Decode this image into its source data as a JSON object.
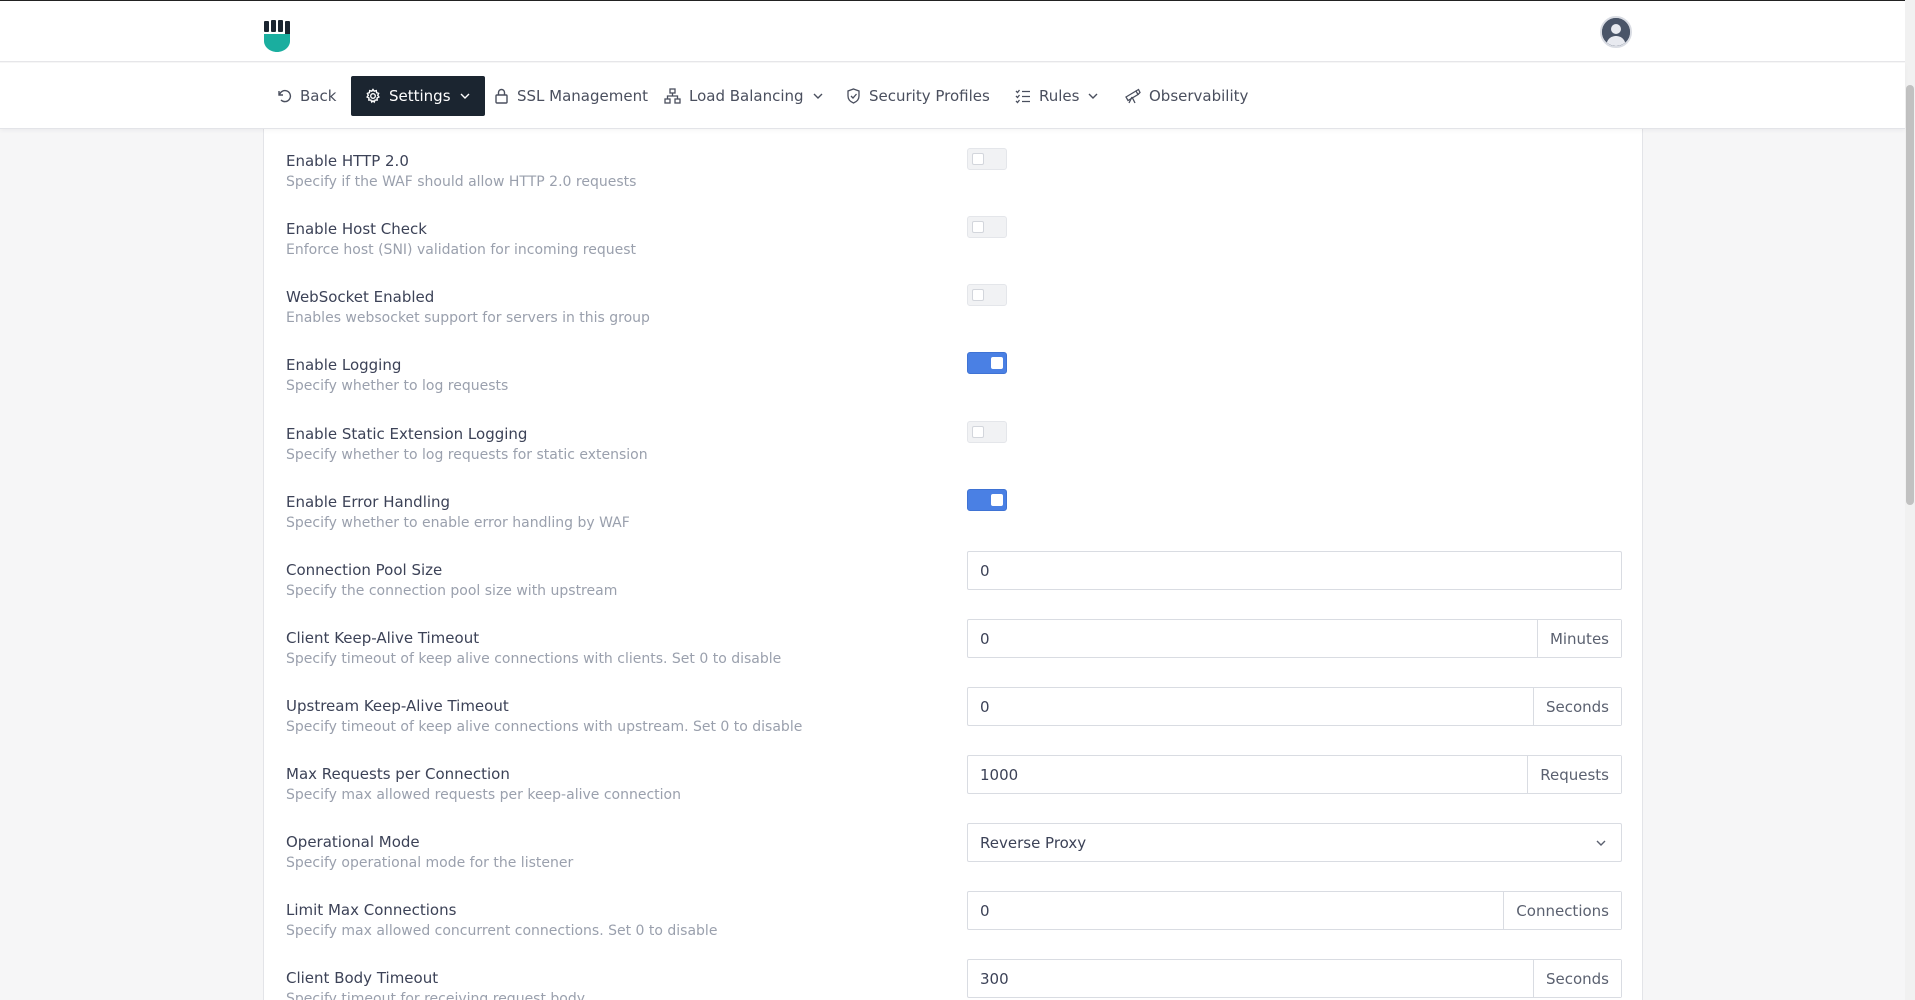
{
  "nav": {
    "back": "Back",
    "settings": "Settings",
    "ssl": "SSL Management",
    "load_balancing": "Load Balancing",
    "security_profiles": "Security Profiles",
    "rules": "Rules",
    "observability": "Observability"
  },
  "settings": [
    {
      "label": "Enable HTTP 2.0",
      "desc": "Specify if the WAF should allow HTTP 2.0 requests",
      "enabled": false
    },
    {
      "label": "Enable Host Check",
      "desc": "Enforce host (SNI) validation for incoming request",
      "enabled": false
    },
    {
      "label": "WebSocket Enabled",
      "desc": "Enables websocket support for servers in this group",
      "enabled": false
    },
    {
      "label": "Enable Logging",
      "desc": "Specify whether to log requests",
      "enabled": true
    },
    {
      "label": "Enable Static Extension Logging",
      "desc": "Specify whether to log requests for static extension",
      "enabled": false
    },
    {
      "label": "Enable Error Handling",
      "desc": "Specify whether to enable error handling by WAF",
      "enabled": true
    },
    {
      "label": "Connection Pool Size",
      "desc": "Specify the connection pool size with upstream",
      "value": "0"
    },
    {
      "label": "Client Keep-Alive Timeout",
      "desc": "Specify timeout of keep alive connections with clients. Set 0 to disable",
      "value": "0",
      "unit": "Minutes"
    },
    {
      "label": "Upstream Keep-Alive Timeout",
      "desc": "Specify timeout of keep alive connections with upstream. Set 0 to disable",
      "value": "0",
      "unit": "Seconds"
    },
    {
      "label": "Max Requests per Connection",
      "desc": "Specify max allowed requests per keep-alive connection",
      "value": "1000",
      "unit": "Requests"
    },
    {
      "label": "Operational Mode",
      "desc": "Specify operational mode for the listener",
      "value": "Reverse Proxy"
    },
    {
      "label": "Limit Max Connections",
      "desc": "Specify max allowed concurrent connections. Set 0 to disable",
      "value": "0",
      "unit": "Connections"
    },
    {
      "label": "Client Body Timeout",
      "desc": "Specify timeout for receiving request body",
      "value": "300",
      "unit": "Seconds"
    }
  ],
  "colors": {
    "accent": "#4a80e4",
    "nav_active_bg": "#1b2530",
    "logo": "#1aae9f"
  }
}
